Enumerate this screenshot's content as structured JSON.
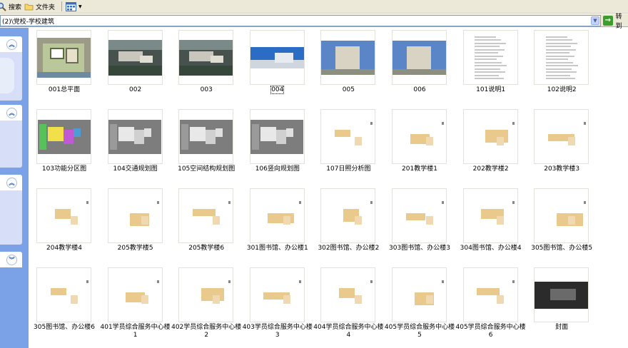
{
  "toolbar": {
    "search_label": "搜索",
    "folders_label": "文件夹"
  },
  "address": {
    "path": "(2)\\党校-学校建筑",
    "go_label": "转到"
  },
  "items": [
    {
      "label": "001总平面",
      "kind": "site"
    },
    {
      "label": "002",
      "kind": "aerial"
    },
    {
      "label": "003",
      "kind": "aerial"
    },
    {
      "label": "004",
      "kind": "sky"
    },
    {
      "label": "005",
      "kind": "photo"
    },
    {
      "label": "006",
      "kind": "photo"
    },
    {
      "label": "101说明1",
      "kind": "doc"
    },
    {
      "label": "102说明2",
      "kind": "doc"
    },
    {
      "label": "103功能分区图",
      "kind": "plan"
    },
    {
      "label": "104交通规划图",
      "kind": "plan"
    },
    {
      "label": "105空间结构规划图",
      "kind": "plan"
    },
    {
      "label": "106竖向规划图",
      "kind": "plan"
    },
    {
      "label": "107日照分析图",
      "kind": "sheet"
    },
    {
      "label": "201教学楼1",
      "kind": "sheet"
    },
    {
      "label": "202教学楼2",
      "kind": "sheet"
    },
    {
      "label": "203教学楼3",
      "kind": "sheet"
    },
    {
      "label": "204教学楼4",
      "kind": "sheet"
    },
    {
      "label": "205教学楼5",
      "kind": "sheet"
    },
    {
      "label": "205教学楼6",
      "kind": "sheet"
    },
    {
      "label": "301图书馆、办公楼1",
      "kind": "sheet"
    },
    {
      "label": "302图书馆、办公楼2",
      "kind": "sheet"
    },
    {
      "label": "303图书馆、办公楼3",
      "kind": "sheet"
    },
    {
      "label": "304图书馆、办公楼4",
      "kind": "sheet"
    },
    {
      "label": "305图书馆、办公楼5",
      "kind": "sheet"
    },
    {
      "label": "305图书馆、办公楼6",
      "kind": "sheet"
    },
    {
      "label": "401学员综合服务中心楼1",
      "kind": "sheet"
    },
    {
      "label": "402学员综合服务中心楼2",
      "kind": "sheet"
    },
    {
      "label": "403学员综合服务中心楼3",
      "kind": "sheet"
    },
    {
      "label": "404学员综合服务中心楼4",
      "kind": "sheet"
    },
    {
      "label": "405学员综合服务中心楼5",
      "kind": "sheet"
    },
    {
      "label": "405学员综合服务中心楼6",
      "kind": "sheet"
    },
    {
      "label": "封面",
      "kind": "dark"
    }
  ],
  "selected_item": "004",
  "colors": {
    "task_pane": "#7ba2e7",
    "toolbar": "#ece9d8",
    "selection": "#316ac5"
  }
}
